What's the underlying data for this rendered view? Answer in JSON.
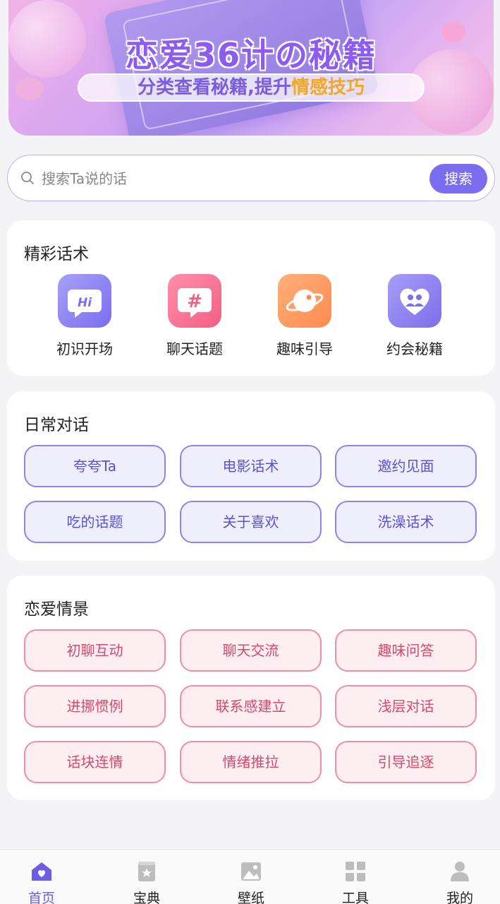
{
  "banner": {
    "title": "恋爱36计の秘籍",
    "subtitle_prefix": "分类查看秘籍,提升",
    "subtitle_highlight": "情感技巧"
  },
  "search": {
    "placeholder": "搜索Ta说的话",
    "button_label": "搜索"
  },
  "features": {
    "title": "精彩话术",
    "items": [
      {
        "label": "初识开场",
        "icon": "hi-bubble-icon",
        "badge": "Hi"
      },
      {
        "label": "聊天话题",
        "icon": "hashtag-icon",
        "badge": "#"
      },
      {
        "label": "趣味引导",
        "icon": "planet-icon"
      },
      {
        "label": "约会秘籍",
        "icon": "heart-couple-icon"
      }
    ]
  },
  "daily": {
    "title": "日常对话",
    "chips": [
      "夸夸Ta",
      "电影话术",
      "邀约见面",
      "吃的话题",
      "关于喜欢",
      "洗澡话术"
    ]
  },
  "scene": {
    "title": "恋爱情景",
    "chips": [
      "初聊互动",
      "聊天交流",
      "趣味问答",
      "进挪惯例",
      "联系感建立",
      "浅层对话",
      "话块连情",
      "情绪推拉",
      "引导追逐"
    ]
  },
  "nav": {
    "items": [
      {
        "label": "首页",
        "icon": "home-icon",
        "active": true
      },
      {
        "label": "宝典",
        "icon": "book-icon",
        "active": false
      },
      {
        "label": "壁纸",
        "icon": "image-icon",
        "active": false
      },
      {
        "label": "工具",
        "icon": "grid-icon",
        "active": false
      },
      {
        "label": "我的",
        "icon": "person-icon",
        "active": false
      }
    ]
  },
  "colors": {
    "accent": "#7b6df0",
    "blue_chip_border": "#8e84ee",
    "pink_chip_border": "#f08ea4",
    "highlight": "#f5a623"
  }
}
